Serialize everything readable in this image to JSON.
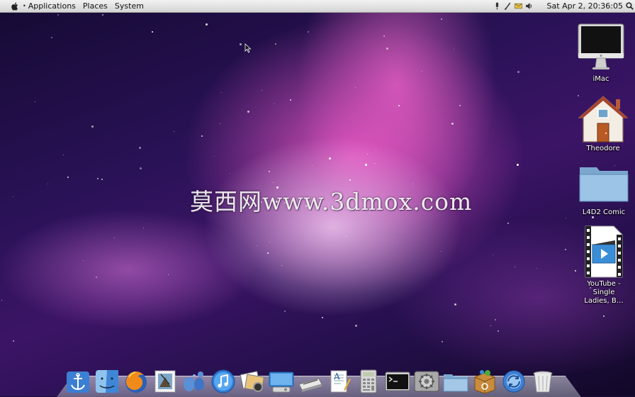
{
  "top_panel": {
    "menus": [
      "Applications",
      "Places",
      "System"
    ],
    "clock": "Sat Apr  2, 20:36:05"
  },
  "watermark": "莫西网www.3dmox.com",
  "desktop_icons": [
    {
      "label": "iMac",
      "icon": "imac-icon"
    },
    {
      "label": "Theodore",
      "icon": "home-folder-icon"
    },
    {
      "label": "L4D2 Comic",
      "icon": "folder-icon"
    },
    {
      "label": "YouTube - Single Ladies, B…",
      "icon": "video-file-icon"
    }
  ],
  "dock_items": [
    "anchor-icon",
    "finder-icon",
    "firefox-icon",
    "mail-stamp-icon",
    "chat-bubbles-icon",
    "itunes-icon",
    "photo-icon",
    "screen-icon",
    "scanner-icon",
    "text-editor-icon",
    "calculator-icon",
    "terminal-icon",
    "settings-icon",
    "folder-icon",
    "package-icon",
    "update-icon",
    "trash-icon"
  ],
  "colors": {
    "panel": "#e6e6e6",
    "folder": "#8fb8dc",
    "accent": "#2f6fd0"
  }
}
